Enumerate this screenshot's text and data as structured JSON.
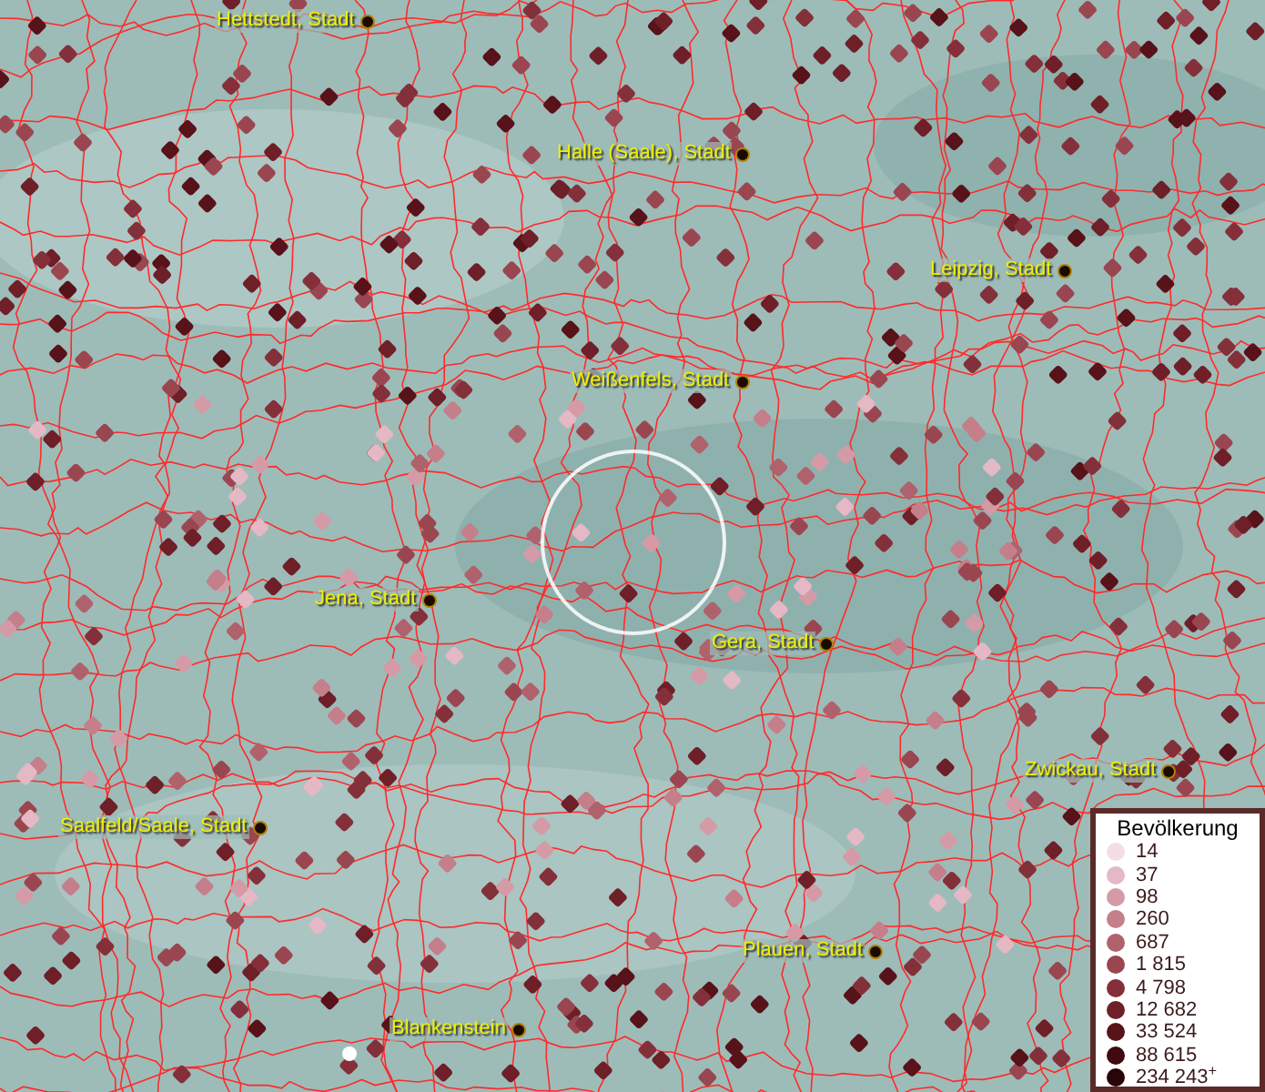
{
  "places": [
    {
      "label": "Hettstedt, Stadt"
    },
    {
      "label": "Halle (Saale), Stadt"
    },
    {
      "label": "Leipzig, Stadt"
    },
    {
      "label": "Weißenfels, Stadt"
    },
    {
      "label": "Jena, Stadt"
    },
    {
      "label": "Gera, Stadt"
    },
    {
      "label": "Zwickau, Stadt"
    },
    {
      "label": "Saalfeld/Saale, Stadt"
    },
    {
      "label": "Plauen, Stadt"
    },
    {
      "label": "Blankenstein"
    }
  ],
  "legend": {
    "title": "Bevölkerung",
    "entries": [
      {
        "label": "14",
        "color": "#f4dde6"
      },
      {
        "label": "37",
        "color": "#e4b8c4"
      },
      {
        "label": "98",
        "color": "#d49ba6"
      },
      {
        "label": "260",
        "color": "#c47f8a"
      },
      {
        "label": "687",
        "color": "#b0626c"
      },
      {
        "label": "1 815",
        "color": "#9a4650"
      },
      {
        "label": "4 798",
        "color": "#84303a"
      },
      {
        "label": "12 682",
        "color": "#6e1f28"
      },
      {
        "label": "33 524",
        "color": "#581219"
      },
      {
        "label": "88 615",
        "color": "#400a10"
      },
      {
        "label": "234 243$^{+}$",
        "color": "#2a0508"
      }
    ]
  }
}
